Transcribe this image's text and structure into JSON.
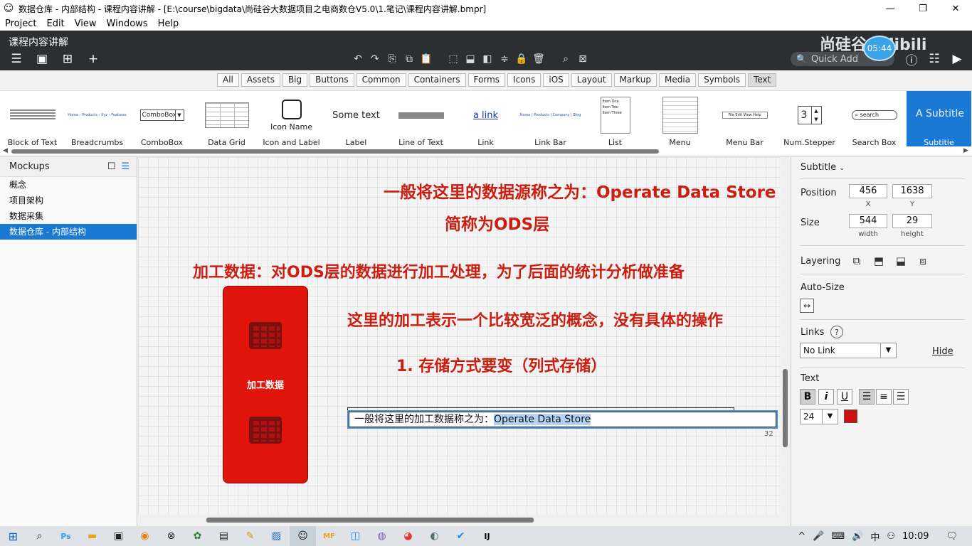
{
  "window": {
    "title": "数据仓库 - 内部结构 - 课程内容讲解 - [E:\\course\\bigdata\\尚硅谷大数据项目之电商数仓V5.0\\1.笔记\\课程内容讲解.bmpr]",
    "minimize": "—",
    "maximize": "❐",
    "close": "✕"
  },
  "menu": [
    "Project",
    "Edit",
    "View",
    "Windows",
    "Help"
  ],
  "toolbar": {
    "doc_title": "课程内容讲解",
    "quick_add_placeholder": "Quick Add",
    "watermark": "尚硅谷 bilibili",
    "time_badge": "05:44"
  },
  "filter_tabs": [
    "All",
    "Assets",
    "Big",
    "Buttons",
    "Common",
    "Containers",
    "Forms",
    "Icons",
    "iOS",
    "Layout",
    "Markup",
    "Media",
    "Symbols",
    "Text"
  ],
  "filter_active": "Text",
  "library": {
    "items": [
      {
        "label": "Block of Text"
      },
      {
        "label": "Breadcrumbs",
        "preview": "Home › Products › Xyz › Features"
      },
      {
        "label": "ComboBox",
        "preview": "ComboBox"
      },
      {
        "label": "Data Grid"
      },
      {
        "label": "Icon and Label",
        "preview": "Icon Name"
      },
      {
        "label": "Label",
        "preview": "Some text"
      },
      {
        "label": "Line of Text"
      },
      {
        "label": "Link",
        "preview": "a link"
      },
      {
        "label": "Link Bar",
        "preview": "Home | Products | Company | Blog"
      },
      {
        "label": "List",
        "preview": [
          "Item One",
          "Item Two",
          "Item Three"
        ]
      },
      {
        "label": "Menu"
      },
      {
        "label": "Menu Bar",
        "preview": "File Edit View Help"
      },
      {
        "label": "Num.Stepper",
        "preview": "3"
      },
      {
        "label": "Search Box",
        "preview": "search"
      },
      {
        "label": "Subtitle",
        "preview": "A Subtitle"
      }
    ],
    "selected": "Subtitle"
  },
  "mockups": {
    "header": "Mockups",
    "items": [
      "概念",
      "项目架构",
      "数据采集",
      "数据仓库 - 内部结构"
    ],
    "selected": "数据仓库 - 内部结构"
  },
  "canvas": {
    "texts": [
      "一般将这里的数据源称之为：Operate Data Store",
      "简称为ODS层",
      "加工数据：对ODS层的数据进行加工处理，为了后面的统计分析做准备",
      "这里的加工表示一个比较宽泛的概念，没有具体的操作",
      "1. 存储方式要变（列式存储）"
    ],
    "block_label": "加工数据",
    "edit": {
      "prefix": "一般将这里的加工数据称之为：",
      "selected": "Operate Data Store",
      "count": "32"
    }
  },
  "inspector": {
    "title": "Subtitle",
    "position_label": "Position",
    "x": "456",
    "y": "1638",
    "x_label": "X",
    "y_label": "Y",
    "size_label": "Size",
    "width": "544",
    "height": "29",
    "width_label": "width",
    "height_label": "height",
    "layering_label": "Layering",
    "autosize_label": "Auto-Size",
    "links_label": "Links",
    "links_help": "?",
    "link_value": "No Link",
    "hide_label": "Hide",
    "text_label": "Text",
    "bold": "B",
    "italic": "i",
    "underline": "U",
    "font_size": "24",
    "text_color": "#cc1010"
  },
  "taskbar": {
    "tray": [
      "^",
      "🎤",
      "⌨",
      "🔊",
      "中"
    ],
    "time": "10:09"
  }
}
